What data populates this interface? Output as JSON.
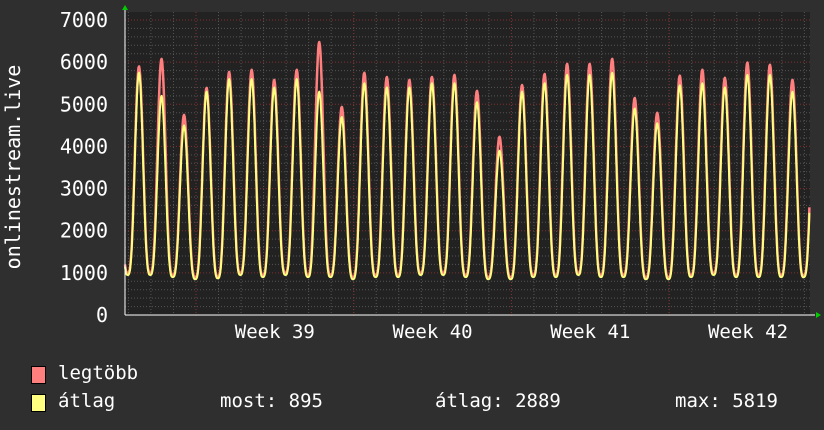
{
  "chart_data": {
    "type": "line",
    "ylabel": "onlinestream.live",
    "ylim": [
      0,
      7000
    ],
    "yticks": [
      "0",
      "1000",
      "2000",
      "3000",
      "4000",
      "5000",
      "6000",
      "7000"
    ],
    "xlim_days": [
      0,
      30.4
    ],
    "xtick_labels": [
      "Week 39",
      "Week 40",
      "Week 41",
      "Week 42"
    ],
    "week_starts_days": [
      3.15,
      10.15,
      17.15,
      24.15
    ],
    "grid": true,
    "series": [
      {
        "name": "legtöbb",
        "color": "#ff7f7f",
        "daily_peaks": [
          5900,
          6080,
          4750,
          5390,
          5770,
          5820,
          5580,
          5820,
          6480,
          4940,
          5750,
          5650,
          5580,
          5650,
          5700,
          5320,
          4230,
          5460,
          5720,
          5960,
          5960,
          6080,
          5150,
          4800,
          5680,
          5820,
          5630,
          5990,
          5940,
          5580
        ],
        "daily_troughs": [
          1000,
          950,
          900,
          920,
          1000,
          950,
          1000,
          950,
          950,
          900,
          950,
          950,
          1000,
          1000,
          950,
          900,
          900,
          950,
          950,
          1000,
          950,
          950,
          900,
          900,
          950,
          1000,
          950,
          950,
          950,
          900
        ]
      },
      {
        "name": "átlag",
        "color": "#ffff80",
        "daily_peaks": [
          5750,
          5200,
          4500,
          5300,
          5600,
          5600,
          5400,
          5600,
          5300,
          4700,
          5500,
          5400,
          5400,
          5500,
          5500,
          5050,
          3900,
          5300,
          5500,
          5700,
          5700,
          5750,
          4900,
          4550,
          5450,
          5500,
          5400,
          5700,
          5700,
          5300
        ],
        "daily_troughs": [
          950,
          900,
          850,
          870,
          950,
          900,
          950,
          900,
          900,
          850,
          900,
          900,
          950,
          950,
          900,
          850,
          850,
          900,
          900,
          950,
          900,
          900,
          850,
          850,
          900,
          950,
          900,
          900,
          900,
          895
        ]
      }
    ],
    "legend": {
      "items": [
        "legtöbb",
        "átlag"
      ],
      "placement": "bottom-left",
      "stats": {
        "most_label": "most:",
        "most": "895",
        "atlag_label": "átlag:",
        "atlag": "2889",
        "max_label": "max:",
        "max": "5819"
      }
    }
  }
}
